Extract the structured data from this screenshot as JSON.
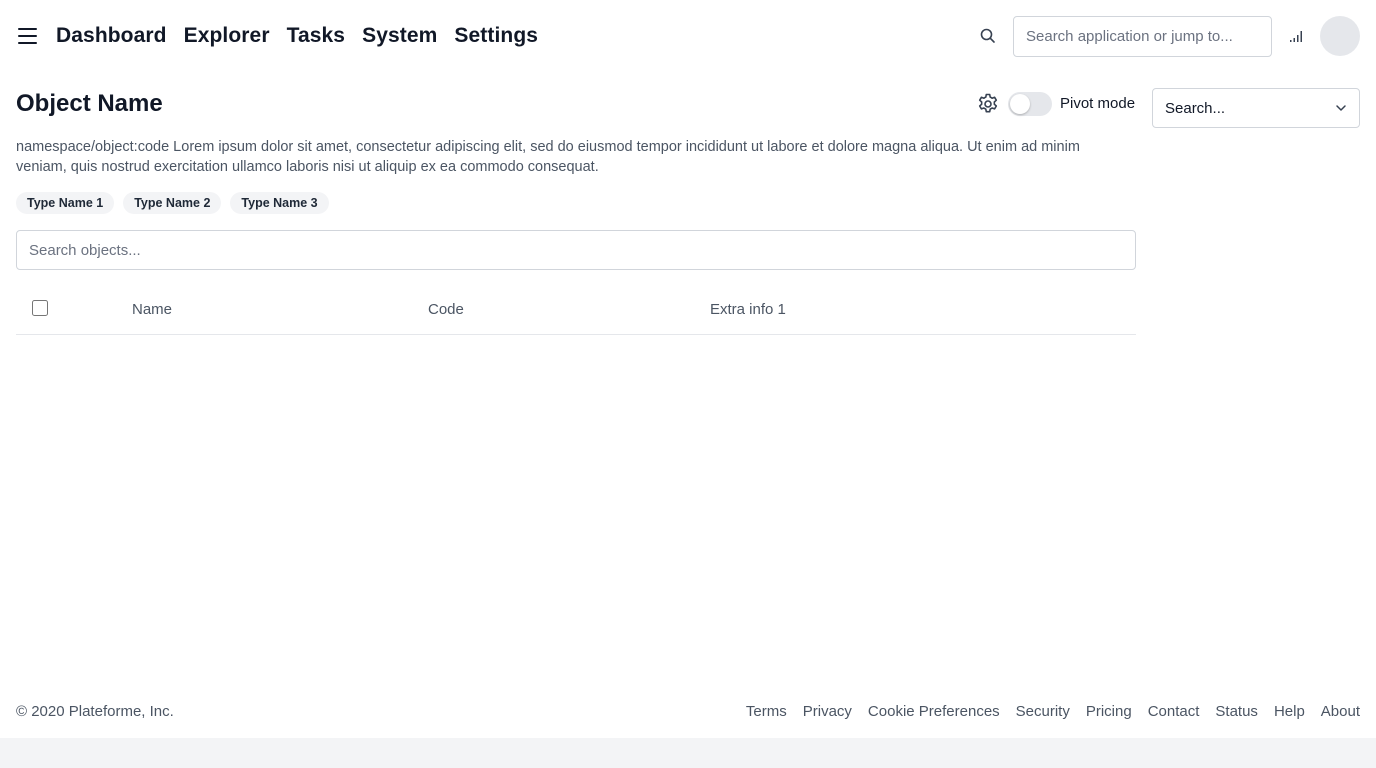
{
  "header": {
    "nav": [
      "Dashboard",
      "Explorer",
      "Tasks",
      "System",
      "Settings"
    ],
    "search_placeholder": "Search application or jump to..."
  },
  "main": {
    "title": "Object Name",
    "pivot_label": "Pivot mode",
    "pivot_enabled": false,
    "select_value": "Search...",
    "description": "namespace/object:code Lorem ipsum dolor sit amet, consectetur adipiscing elit, sed do eiusmod tempor incididunt ut labore et dolore magna aliqua. Ut enim ad minim veniam, quis nostrud exercitation ullamco laboris nisi ut aliquip ex ea commodo consequat.",
    "types": [
      "Type Name 1",
      "Type Name 2",
      "Type Name 3"
    ],
    "search_placeholder": "Search objects...",
    "columns": [
      "Name",
      "Code",
      "Extra info 1"
    ]
  },
  "footer": {
    "copyright": "© 2020 Plateforme, Inc.",
    "links": [
      "Terms",
      "Privacy",
      "Cookie Preferences",
      "Security",
      "Pricing",
      "Contact",
      "Status",
      "Help",
      "About"
    ]
  },
  "colors": {
    "text": "#111827",
    "muted": "#4b5563",
    "border": "#d1d5db",
    "chip_bg": "#f3f4f6"
  }
}
